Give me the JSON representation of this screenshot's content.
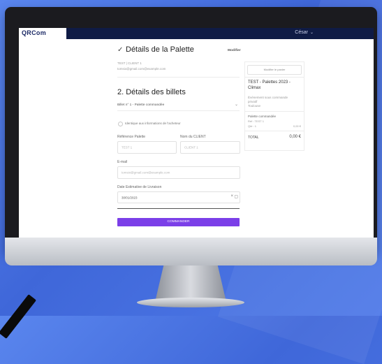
{
  "app": {
    "logo": "QRCom",
    "user": "César",
    "brand_color": "#0f1b45",
    "accent_color": "#7b3fe8"
  },
  "palette_section": {
    "check_icon": "check-icon",
    "title": "Détails de la Palette",
    "edit_link": "Modifier",
    "client_line": "TEST | CLIENT 1",
    "email_line": "tomsix@gmail.com@example.com"
  },
  "tickets_section": {
    "title": "2.  Détails des billets",
    "accordion_label": "Billet n° 1 - Palette commandée",
    "checkbox_label": "Identique aux informations de l'acheteur",
    "fields": {
      "palette_label": "Référence Palette",
      "palette_value": "TEST 1",
      "client_label": "Nom du CLIENT",
      "client_value": "CLIENT 1",
      "email_label": "E-mail",
      "email_value": "tomsix@gmail.com@example.com",
      "date_label": "Date Estimative de Livraison",
      "date_value": "30/01/2023"
    },
    "submit_label": "COMMANDER"
  },
  "summary": {
    "edit_button": "Modifier le panier",
    "event_title": "TEST - Palettes 2023 - Climax",
    "event_lines": [
      "Événement sous commande",
      "privatif",
      "Toulouse"
    ],
    "item_title": "Palette commandée",
    "item_sub": "Réf : TEST 1",
    "item_qty": "Qté : 1",
    "item_price": "0,00 €",
    "total_label": "TOTAL",
    "total_value": "0,00 €"
  }
}
